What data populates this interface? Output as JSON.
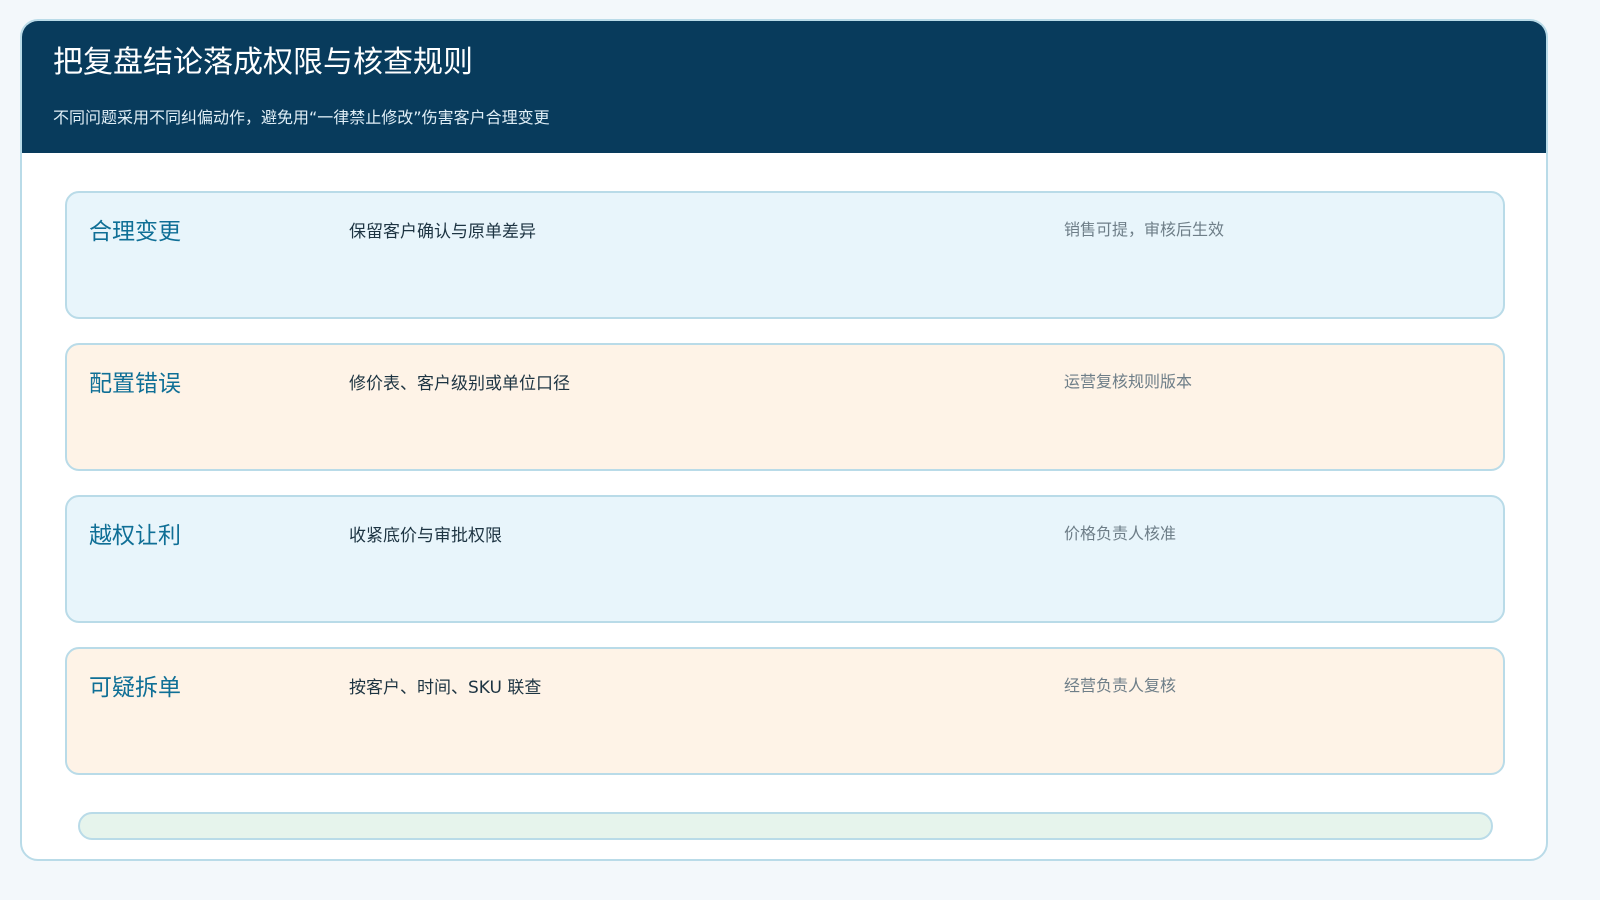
{
  "header": {
    "title": "把复盘结论落成权限与核查规则",
    "subtitle": "不同问题采用不同纠偏动作，避免用“一律禁止修改”伤害客户合理变更"
  },
  "rules": [
    {
      "label": "合理变更",
      "action": "保留客户确认与原单差异",
      "owner": "销售可提，审核后生效",
      "tint": "#e8f5fb"
    },
    {
      "label": "配置错误",
      "action": "修价表、客户级别或单位口径",
      "owner": "运营复核规则版本",
      "tint": "#fef3e7"
    },
    {
      "label": "越权让利",
      "action": "收紧底价与审批权限",
      "owner": "价格负责人核准",
      "tint": "#e8f5fb"
    },
    {
      "label": "可疑拆单",
      "action": "按客户、时间、SKU 联查",
      "owner": "经营负责人复核",
      "tint": "#fef3e7"
    }
  ],
  "colors": {
    "header_bg": "#083b5c",
    "accent": "#0f6f96",
    "border": "#b9dbe8",
    "footer_bar": "#e6f4ec"
  }
}
